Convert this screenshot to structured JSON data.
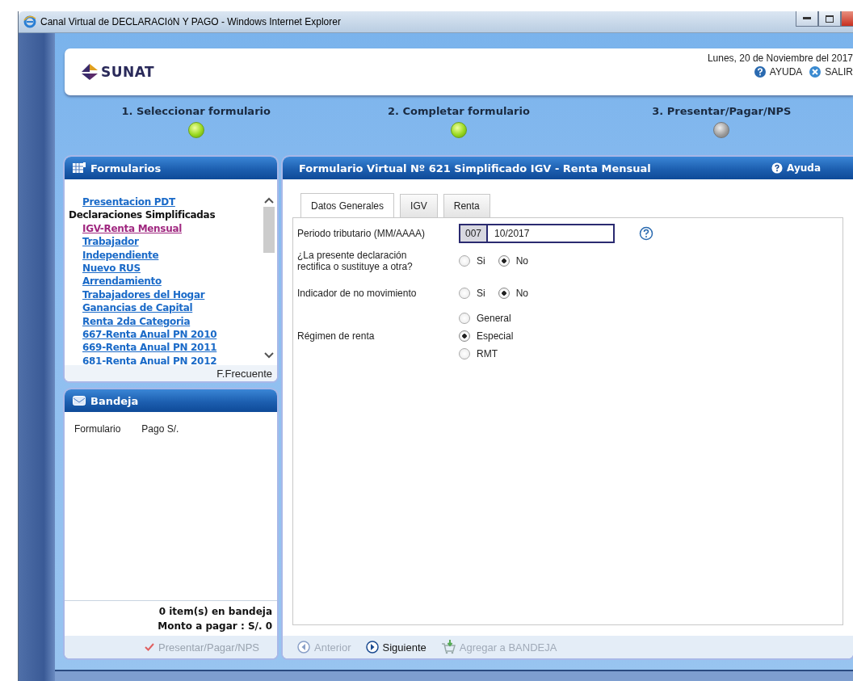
{
  "window": {
    "title": "Canal Virtual de DECLARACIóN Y PAGO - Windows Internet Explorer"
  },
  "header": {
    "logo": "SUNAT",
    "date": "Lunes, 20 de Noviembre del 2017",
    "links": [
      {
        "label": "AYUDA",
        "kind": "help"
      },
      {
        "label": "SALIR",
        "kind": "exit"
      }
    ]
  },
  "steps": [
    {
      "label": "1. Seleccionar formulario",
      "done": true
    },
    {
      "label": "2. Completar formulario",
      "done": true
    },
    {
      "label": "3. Presentar/Pagar/NPS",
      "done": false
    }
  ],
  "formularios": {
    "title": "Formularios",
    "items": [
      {
        "label": "Presentacion PDT",
        "kind": "link",
        "selected": false
      },
      {
        "label": "Declaraciones Simplificadas",
        "kind": "heading"
      },
      {
        "label": "IGV-Renta Mensual",
        "kind": "link",
        "selected": true
      },
      {
        "label": "Trabajador",
        "kind": "link",
        "selected": false
      },
      {
        "label": "Independiente",
        "kind": "link",
        "selected": false
      },
      {
        "label": "Nuevo RUS",
        "kind": "link",
        "selected": false
      },
      {
        "label": "Arrendamiento",
        "kind": "link",
        "selected": false
      },
      {
        "label": "Trabajadores del Hogar",
        "kind": "link",
        "selected": false
      },
      {
        "label": "Ganancias de Capital",
        "kind": "link",
        "selected": false
      },
      {
        "label": "Renta 2da Categoria",
        "kind": "link",
        "selected": false
      },
      {
        "label": "667-Renta Anual PN 2010",
        "kind": "link",
        "selected": false
      },
      {
        "label": "669-Renta Anual PN 2011",
        "kind": "link",
        "selected": false
      },
      {
        "label": "681-Renta Anual PN 2012",
        "kind": "link",
        "selected": false
      }
    ],
    "footer": "F.Frecuente"
  },
  "bandeja": {
    "title": "Bandeja",
    "columns": [
      "Formulario",
      "Pago S/."
    ],
    "summary": [
      "0 item(s) en bandeja",
      "Monto a pagar : S/. 0"
    ],
    "action": {
      "label": "Presentar/Pagar/NPS",
      "disabled": true
    }
  },
  "form": {
    "title": "Formulario Virtual Nº 621 Simplificado IGV - Renta Mensual",
    "help": "Ayuda",
    "tabs": [
      {
        "label": "Datos Generales",
        "selected": true
      },
      {
        "label": "IGV",
        "selected": false
      },
      {
        "label": "Renta",
        "selected": false
      }
    ],
    "period": {
      "label": "Periodo tributario (MM/AAAA)",
      "prefix": "007",
      "value": "10/2017"
    },
    "questions": [
      {
        "label": "¿La presente declaración rectifica o sustituye a otra?",
        "kind": "inline",
        "options": [
          {
            "label": "Si",
            "selected": false
          },
          {
            "label": "No",
            "selected": true
          }
        ]
      },
      {
        "label": "Indicador de no movimiento",
        "kind": "inline",
        "options": [
          {
            "label": "Si",
            "selected": false
          },
          {
            "label": "No",
            "selected": true
          }
        ]
      },
      {
        "label": "Régimen de renta",
        "kind": "stacked",
        "options": [
          {
            "label": "General",
            "selected": false
          },
          {
            "label": "Especial",
            "selected": true
          },
          {
            "label": "RMT",
            "selected": false
          }
        ]
      }
    ],
    "nav": [
      {
        "label": "Anterior",
        "kind": "prev",
        "disabled": true
      },
      {
        "label": "Siguiente",
        "kind": "next",
        "disabled": false
      },
      {
        "label": "Agregar a BANDEJA",
        "kind": "cart",
        "disabled": true
      }
    ]
  }
}
